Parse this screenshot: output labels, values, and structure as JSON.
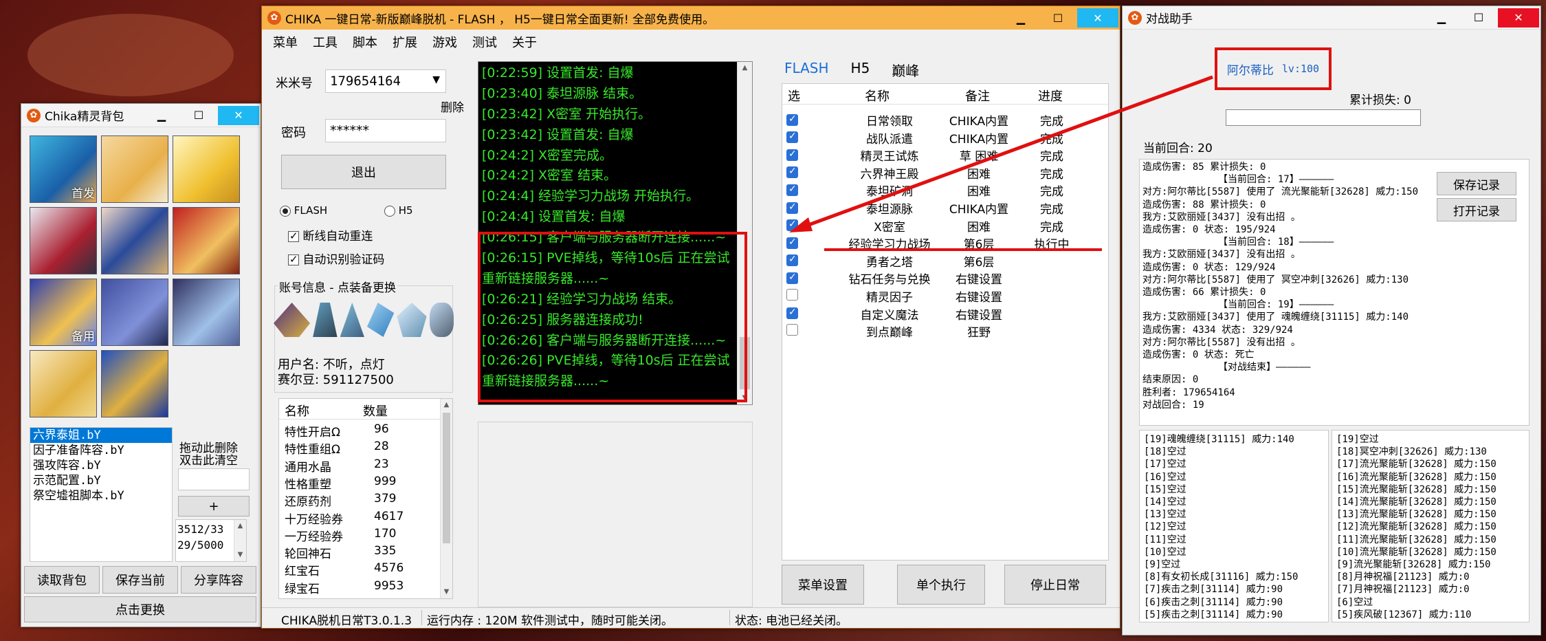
{
  "bag_window": {
    "title": "Chika精灵背包",
    "avatar_badges": {
      "first": "首发",
      "backup": "备用"
    },
    "lineups": [
      "六界泰姐.bY",
      "因子准备阵容.bY",
      "强攻阵容.bY",
      "示范配置.bY",
      "祭空墟祖脚本.bY"
    ],
    "drag_hint_line1": "拖动此删除",
    "drag_hint_line2": "双击此清空",
    "plus_label": "+",
    "counter_line1": "3512/33",
    "counter_line2": "29/5000",
    "buttons": {
      "read": "读取背包",
      "save": "保存当前",
      "share": "分享阵容",
      "replace": "点击更换"
    }
  },
  "main_window": {
    "title": "CHIKA 一键日常-新版巅峰脱机 - FLASH ， H5一键日常全面更新! 全部免费使用。",
    "menu": [
      "菜单",
      "工具",
      "脚本",
      "扩展",
      "游戏",
      "测试",
      "关于"
    ],
    "account_label": "米米号",
    "account_value": "179654164",
    "delete_label": "删除",
    "password_label": "密码",
    "password_value": "******",
    "logout_button": "退出",
    "mode_flash": "FLASH",
    "mode_h5": "H5",
    "auto_reconnect": "断线自动重连",
    "auto_captcha": "自动识别验证码",
    "account_info_title": "账号信息 - 点装备更换",
    "username_line": "用户名: 不听，点灯",
    "bean_line": "赛尔豆: 591127500",
    "items_headers": {
      "name": "名称",
      "count": "数量"
    },
    "items": [
      {
        "name": "特性开启Ω",
        "count": "96"
      },
      {
        "name": "特性重组Ω",
        "count": "28"
      },
      {
        "name": "通用水晶",
        "count": "23"
      },
      {
        "name": "性格重塑",
        "count": "999"
      },
      {
        "name": "还原药剂",
        "count": "379"
      },
      {
        "name": "十万经验券",
        "count": "4617"
      },
      {
        "name": "一万经验券",
        "count": "170"
      },
      {
        "name": "轮回神石",
        "count": "335"
      },
      {
        "name": "红宝石",
        "count": "4576"
      },
      {
        "name": "绿宝石",
        "count": "9953"
      }
    ],
    "log_lines": [
      "[0:22:59] 设置首发: 自爆",
      "[0:23:40] 泰坦源脉 结束。",
      "[0:23:42] X密室 开始执行。",
      "[0:23:42] 设置首发: 自爆",
      "[0:24:2] X密室完成。",
      "[0:24:2] X密室 结束。",
      "[0:24:4] 经验学习力战场 开始执行。",
      "[0:24:4] 设置首发: 自爆",
      "[0:26:15]  客户端与服务器断开连接......~",
      "[0:26:15] PVE掉线，等待10s后 正在尝试",
      "重新链接服务器......~",
      "[0:26:21] 经验学习力战场 结束。",
      "[0:26:25] 服务器连接成功!",
      "[0:26:26]  客户端与服务器断开连接......~",
      "[0:26:26] PVE掉线，等待10s后 正在尝试",
      "重新链接服务器......~"
    ],
    "tabs": [
      "FLASH",
      "H5",
      "巅峰"
    ],
    "task_headers": {
      "select": "选",
      "name": "名称",
      "note": "备注",
      "progress": "进度"
    },
    "tasks": [
      {
        "checked": true,
        "name": "日常领取",
        "note": "CHIKA内置",
        "progress": "完成"
      },
      {
        "checked": true,
        "name": "战队派遣",
        "note": "CHIKA内置",
        "progress": "完成"
      },
      {
        "checked": true,
        "name": "精灵王试炼",
        "note": "草 困难",
        "progress": "完成"
      },
      {
        "checked": true,
        "name": "六界神王殿",
        "note": "困难",
        "progress": "完成"
      },
      {
        "checked": true,
        "name": "泰坦矿洞",
        "note": "困难",
        "progress": "完成"
      },
      {
        "checked": true,
        "name": "泰坦源脉",
        "note": "CHIKA内置",
        "progress": "完成"
      },
      {
        "checked": true,
        "name": "X密室",
        "note": "困难",
        "progress": "完成"
      },
      {
        "checked": true,
        "name": "经验学习力战场",
        "note": "第6层",
        "progress": "执行中"
      },
      {
        "checked": true,
        "name": "勇者之塔",
        "note": "第6层",
        "progress": ""
      },
      {
        "checked": true,
        "name": "钻石任务与兑换",
        "note": "右键设置",
        "progress": ""
      },
      {
        "checked": false,
        "name": "精灵因子",
        "note": "右键设置",
        "progress": ""
      },
      {
        "checked": true,
        "name": "自定义魔法",
        "note": "右键设置",
        "progress": ""
      },
      {
        "checked": false,
        "name": "到点巅峰",
        "note": "狂野",
        "progress": ""
      }
    ],
    "buttons": {
      "menu_settings": "菜单设置",
      "single_run": "单个执行",
      "stop": "停止日常"
    },
    "status": {
      "version": "CHIKA脱机日常T3.0.1.3",
      "memory": "运行内存 : 120M 软件测试中，随时可能关闭。",
      "state": "状态: 电池已经关闭。"
    }
  },
  "battle_window": {
    "title": "对战助手",
    "pet_name": "阿尔蒂比",
    "pet_level": "lv:100",
    "cumulative_loss": "累计损失: 0",
    "current_round": "当前回合: 20",
    "save_record": "保存记录",
    "open_record": "打开记录",
    "battle_log": [
      "造成伤害: 85 累计损失: 0",
      "【当前回合: 17】——————",
      "对方:阿尔蒂比[5587] 使用了 流光聚能斩[32628] 威力:150",
      "造成伤害: 88 累计损失: 0",
      "我方:艾欧丽娅[3437] 没有出招 。",
      "造成伤害: 0 状态: 195/924",
      "【当前回合: 18】——————",
      "我方:艾欧丽娅[3437] 没有出招 。",
      "造成伤害: 0 状态: 129/924",
      "对方:阿尔蒂比[5587] 使用了 冥空冲刺[32626] 威力:130",
      "造成伤害: 66 累计损失: 0",
      "【当前回合: 19】——————",
      "我方:艾欧丽娅[3437] 使用了 魂魄缠绕[31115] 威力:140",
      "造成伤害: 4334 状态: 329/924",
      "对方:阿尔蒂比[5587] 没有出招 。",
      "造成伤害: 0 状态: 死亡",
      "【对战结束】——————",
      "结束原因: 0",
      "胜利者: 179654164",
      "对战回合: 19"
    ],
    "my_moves": [
      "[19]魂魄缠绕[31115] 威力:140",
      "[18]空过",
      "[17]空过",
      "[16]空过",
      "[15]空过",
      "[14]空过",
      "[13]空过",
      "[12]空过",
      "[11]空过",
      "[10]空过",
      "[9]空过",
      "[8]有女初长成[31116] 威力:150",
      "[7]疾击之刺[31114] 威力:90",
      "[6]疾击之刺[31114] 威力:90",
      "[5]疾击之刺[31114] 威力:90"
    ],
    "enemy_moves": [
      "[19]空过",
      "[18]冥空冲刺[32626] 威力:130",
      "[17]流光聚能斩[32628] 威力:150",
      "[16]流光聚能斩[32628] 威力:150",
      "[15]流光聚能斩[32628] 威力:150",
      "[14]流光聚能斩[32628] 威力:150",
      "[13]流光聚能斩[32628] 威力:150",
      "[12]流光聚能斩[32628] 威力:150",
      "[11]流光聚能斩[32628] 威力:150",
      "[10]流光聚能斩[32628] 威力:150",
      "[9]流光聚能斩[32628] 威力:150",
      "[8]月神祝福[21123] 威力:0",
      "[7]月神祝福[21123] 威力:0",
      "[6]空过",
      "[5]疾风破[12367] 威力:110"
    ]
  }
}
